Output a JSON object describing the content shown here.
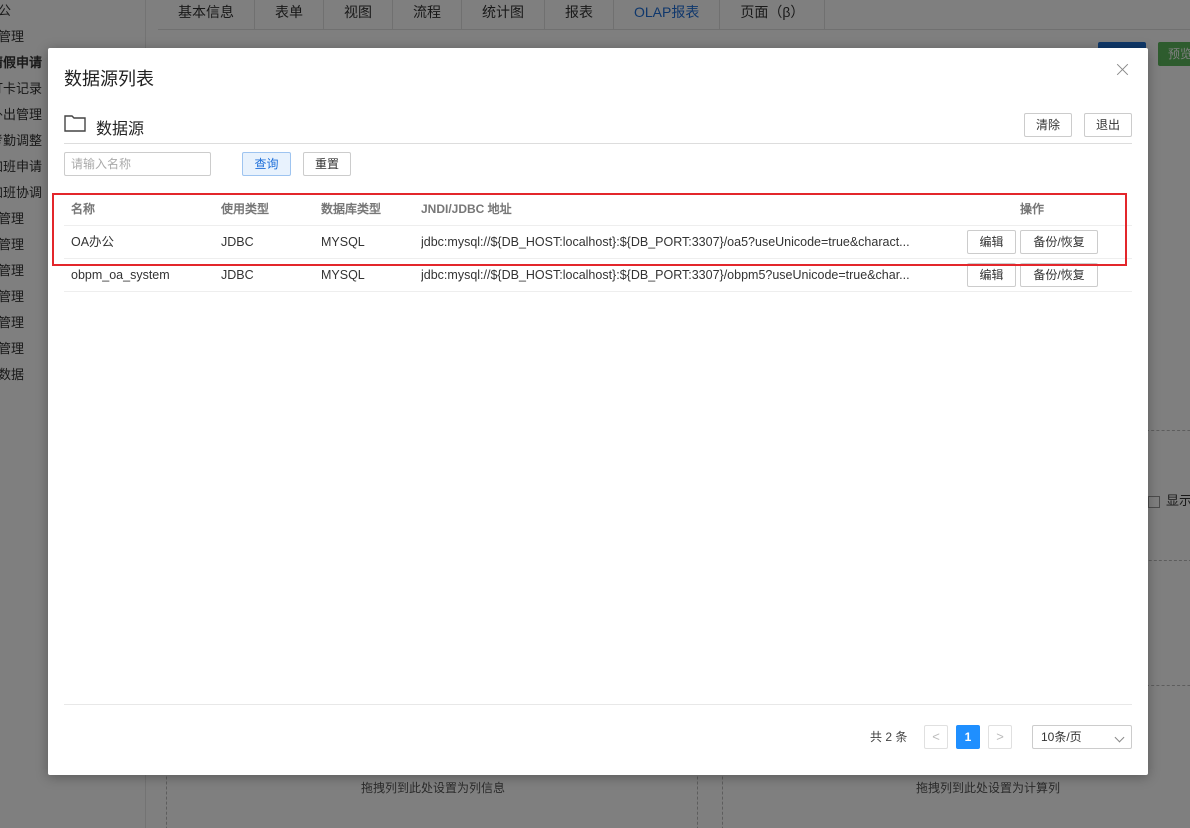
{
  "background": {
    "sidebar_items": [
      "公",
      "管理",
      "请假申请",
      "打卡记录",
      "外出管理",
      "考勤调整",
      "加班申请",
      "加班协调",
      "管理",
      "管理",
      "管理",
      "管理",
      "管理",
      "管理",
      "数据"
    ],
    "tabs": [
      "基本信息",
      "表单",
      "视图",
      "流程",
      "统计图",
      "报表",
      "OLAP报表",
      "页面（β）"
    ],
    "active_tab": "OLAP报表",
    "green_button_label": "预览",
    "show_checkbox_label": "显示",
    "drop_zone_columns": "拖拽列到此处设置为列信息",
    "drop_zone_calc": "拖拽列到此处设置为计算列"
  },
  "modal": {
    "title": "数据源列表",
    "section_title": "数据源",
    "clear_label": "清除",
    "exit_label": "退出",
    "search_placeholder": "请输入名称",
    "query_label": "查询",
    "reset_label": "重置",
    "table": {
      "headers": {
        "name": "名称",
        "usage_type": "使用类型",
        "db_type": "数据库类型",
        "address": "JNDI/JDBC 地址",
        "actions": "操作"
      },
      "rows": [
        {
          "name": "OA办公",
          "usage_type": "JDBC",
          "db_type": "MYSQL",
          "address": "jdbc:mysql://${DB_HOST:localhost}:${DB_PORT:3307}/oa5?useUnicode=true&charact...",
          "edit": "编辑",
          "backup": "备份/恢复"
        },
        {
          "name": "obpm_oa_system",
          "usage_type": "JDBC",
          "db_type": "MYSQL",
          "address": "jdbc:mysql://${DB_HOST:localhost}:${DB_PORT:3307}/obpm5?useUnicode=true&char...",
          "edit": "编辑",
          "backup": "备份/恢复"
        }
      ]
    },
    "pagination": {
      "total_text": "共 2 条",
      "prev": "<",
      "current_page": "1",
      "next": ">",
      "page_size": "10条/页"
    }
  },
  "colors": {
    "accent": "#1f8fff",
    "highlight_box": "#e3262b",
    "active_tab": "#1e6fd9"
  }
}
